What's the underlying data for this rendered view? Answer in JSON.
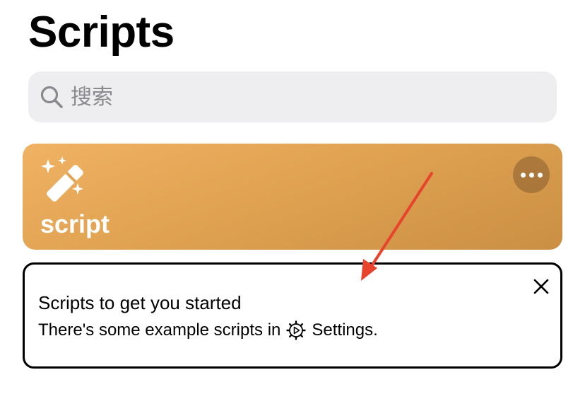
{
  "header": {
    "title": "Scripts"
  },
  "search": {
    "placeholder": "搜索"
  },
  "script_card": {
    "title": "script",
    "icon": "magic-wand-icon",
    "gradient_colors": [
      "#f0b263",
      "#cb8f44"
    ],
    "more_icon": "ellipsis-icon"
  },
  "tip_card": {
    "title": "Scripts to get you started",
    "body_before": "There's some example scripts in",
    "body_icon": "settings-icon",
    "body_after": "Settings.",
    "close_icon": "close-icon"
  },
  "annotation": {
    "arrow_color": "#e8432c"
  }
}
